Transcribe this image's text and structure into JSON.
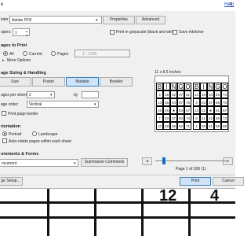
{
  "title": "e",
  "help_label": "Help",
  "close_symbol": "×",
  "printer": {
    "label": "inter",
    "value": "Adobe PDF",
    "properties": "Properties",
    "advanced": "Advanced"
  },
  "copies": {
    "label": "opies:",
    "value": "1"
  },
  "options": {
    "grayscale": "Print in grayscale (black and white)",
    "ink": "Save ink/toner"
  },
  "pages": {
    "title": "ages to Print",
    "all": "All",
    "current": "Current",
    "pages": "Pages",
    "range_placeholder": "1 - 1000",
    "more": "More Options"
  },
  "sizing": {
    "title": "age Sizing & Handling",
    "buttons": [
      "Size",
      "Poster",
      "Multiple",
      "Booklet"
    ],
    "selected": "Multiple",
    "per_sheet_label": "ages per sheet:",
    "per_sheet_value": "2",
    "by_label": "by",
    "order_label": "age order:",
    "order_value": "Vertical",
    "border": "Print page border"
  },
  "orientation": {
    "title": "rientation",
    "portrait": "Portrait",
    "landscape": "Landscape",
    "auto": "Auto-rotate pages within each sheet"
  },
  "comments": {
    "title": "omments & Forms",
    "value": "ocument",
    "summarize": "Summarize Comments"
  },
  "preview": {
    "size": "11 x 8.5 Inches",
    "page_info": "Page 1 of 500 (1)",
    "prev": "◂",
    "next": "▸"
  },
  "bingo": {
    "letters": [
      "B",
      "I",
      "N",
      "G",
      "O"
    ],
    "card1": [
      [
        "3",
        "18",
        "42",
        "47",
        "61"
      ],
      [
        "13",
        "16",
        "44",
        "57",
        "75"
      ],
      [
        "15",
        "26",
        "★",
        "53",
        "67"
      ],
      [
        "7",
        "20",
        "37",
        "50",
        "74"
      ],
      [
        "10",
        "28",
        "36",
        "52",
        "71"
      ]
    ],
    "card2": [
      [
        "14",
        "19",
        "33",
        "53",
        "74"
      ],
      [
        "3",
        "23",
        "37",
        "58",
        "70"
      ],
      [
        "13",
        "22",
        "★",
        "51",
        "67"
      ],
      [
        "8",
        "21",
        "42",
        "49",
        "73"
      ],
      [
        "1",
        "25",
        "41",
        "55",
        "65"
      ]
    ]
  },
  "footer": {
    "setup": "ge Setup...",
    "print": "Print",
    "cancel": "Cancel"
  },
  "background_digits": [
    "12",
    "4"
  ]
}
